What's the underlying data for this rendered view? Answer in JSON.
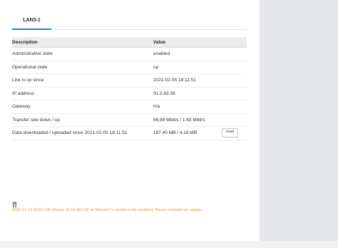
{
  "tabs": [
    {
      "label": "LAN3-1",
      "active": true
    }
  ],
  "table": {
    "headers": [
      "Description",
      "Value"
    ],
    "rows": [
      {
        "label": "Administrative state",
        "value": "enabled"
      },
      {
        "label": "Operational state",
        "value": "up"
      },
      {
        "label": "Link is up since",
        "value": "2021-02-05 18:11:51"
      },
      {
        "label": "IP address",
        "value": "91.5.82.58"
      },
      {
        "label": "Gateway",
        "value": "n/a"
      },
      {
        "label": "Transfer rate down / up",
        "value": "86.99 Mbit/s / 1.63 Mbit/s"
      },
      {
        "label": "Data downloaded / uploaded since 2021-02-05 18:11:51",
        "value": "187.40 MB / 4.16 MB",
        "action": "reset"
      }
    ]
  },
  "notice": {
    "text": "2020-12-14 03:52   FW release 16.19.A01.02 on Module1 is known to be outdated. Please consider an update",
    "icon": "trash-icon"
  },
  "colors": {
    "accent": "#2a7fb8",
    "status_up": "#2eaa2e",
    "notice": "#e8a318"
  }
}
